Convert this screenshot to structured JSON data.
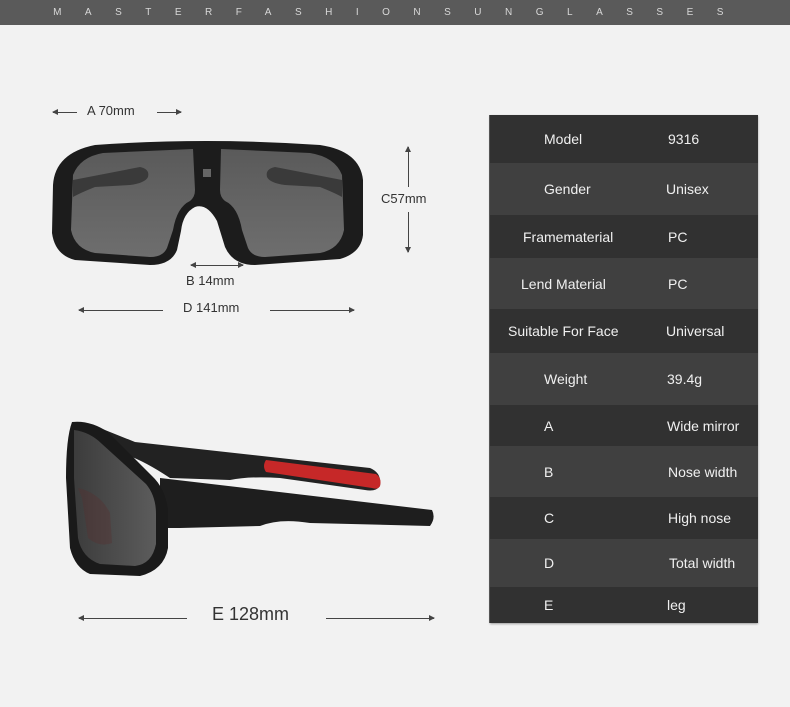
{
  "banner": {
    "title": "MASTERFASHIONSUNGLASSES"
  },
  "dimensions": {
    "a": "A 70mm",
    "b": "B 14mm",
    "c": "C57mm",
    "d": "D 141mm",
    "e": "E 128mm"
  },
  "colors": {
    "banner_bg": "#5a5a5a",
    "page_bg": "#f2f2f2",
    "row_dark": "#313131",
    "row_light": "#404040",
    "temple_accent": "#c62828"
  },
  "specs": [
    {
      "label": "Model",
      "value": "9316"
    },
    {
      "label": "Gender",
      "value": "Unisex"
    },
    {
      "label": "Framematerial",
      "value": "PC"
    },
    {
      "label": "Lend Material",
      "value": "PC"
    },
    {
      "label": "Suitable For Face",
      "value": "Universal"
    },
    {
      "label": "Weight",
      "value": "39.4g"
    },
    {
      "label": "A",
      "value": "Wide mirror"
    },
    {
      "label": "B",
      "value": "Nose width"
    },
    {
      "label": "C",
      "value": "High nose"
    },
    {
      "label": "D",
      "value": "Total width"
    },
    {
      "label": "E",
      "value": "leg"
    }
  ],
  "images": {
    "front": "sunglasses-front-view",
    "side": "sunglasses-side-view"
  }
}
